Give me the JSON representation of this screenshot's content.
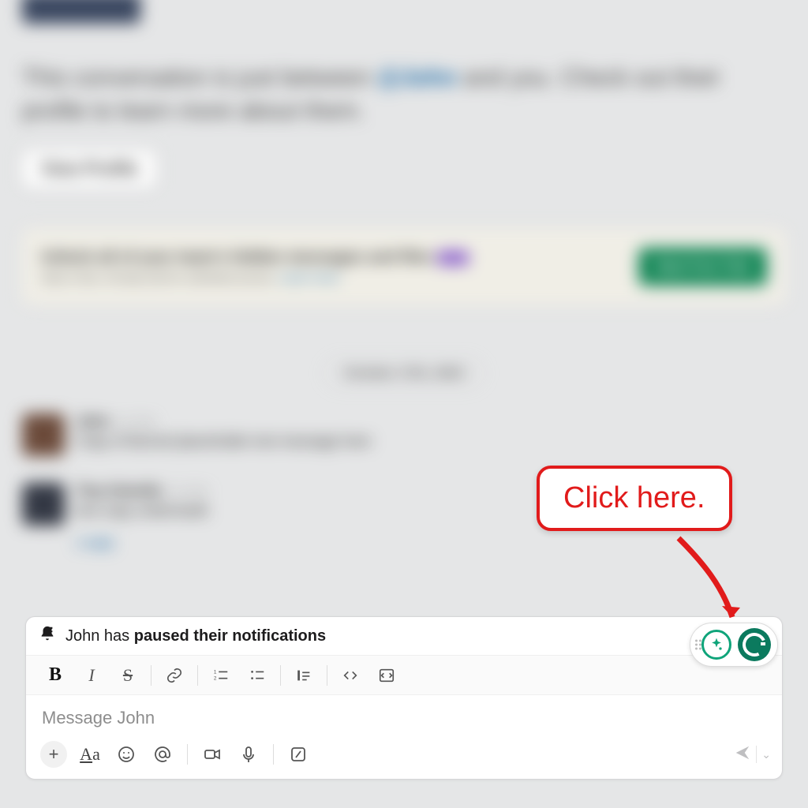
{
  "bg": {
    "intro_a": "This conversation is just between ",
    "intro_mention": "@John",
    "intro_b": " and you. Check out their profile to learn more about them.",
    "view_profile": "View Profile",
    "promo_title": "Unlock all of your team's hidden messages and files",
    "promo_sub_a": "Start a free, 30-day trial for unlimited access. ",
    "promo_sub_link": "Learn more",
    "promo_cta": "Start Free Trial",
    "date": "October 17th, 2023",
    "msg1_name": "John",
    "msg1_ts": "2:47 PM",
    "msg1_body": "Copy of blurred placeholder text message here",
    "msg2_name": "Tina Ostrello",
    "msg2_ts": "3:12 PM",
    "msg2_body": "text copy underneath",
    "reply": "1 reply"
  },
  "notif": {
    "prefix": "John has ",
    "bold": "paused their notifications"
  },
  "input": {
    "placeholder": "Message John"
  },
  "fmt": {
    "bold": "B",
    "italic": "I",
    "strike": "S"
  },
  "actions": {
    "plus": "+",
    "aa_big": "A",
    "aa_small": "a"
  },
  "callout": {
    "text": "Click here."
  }
}
